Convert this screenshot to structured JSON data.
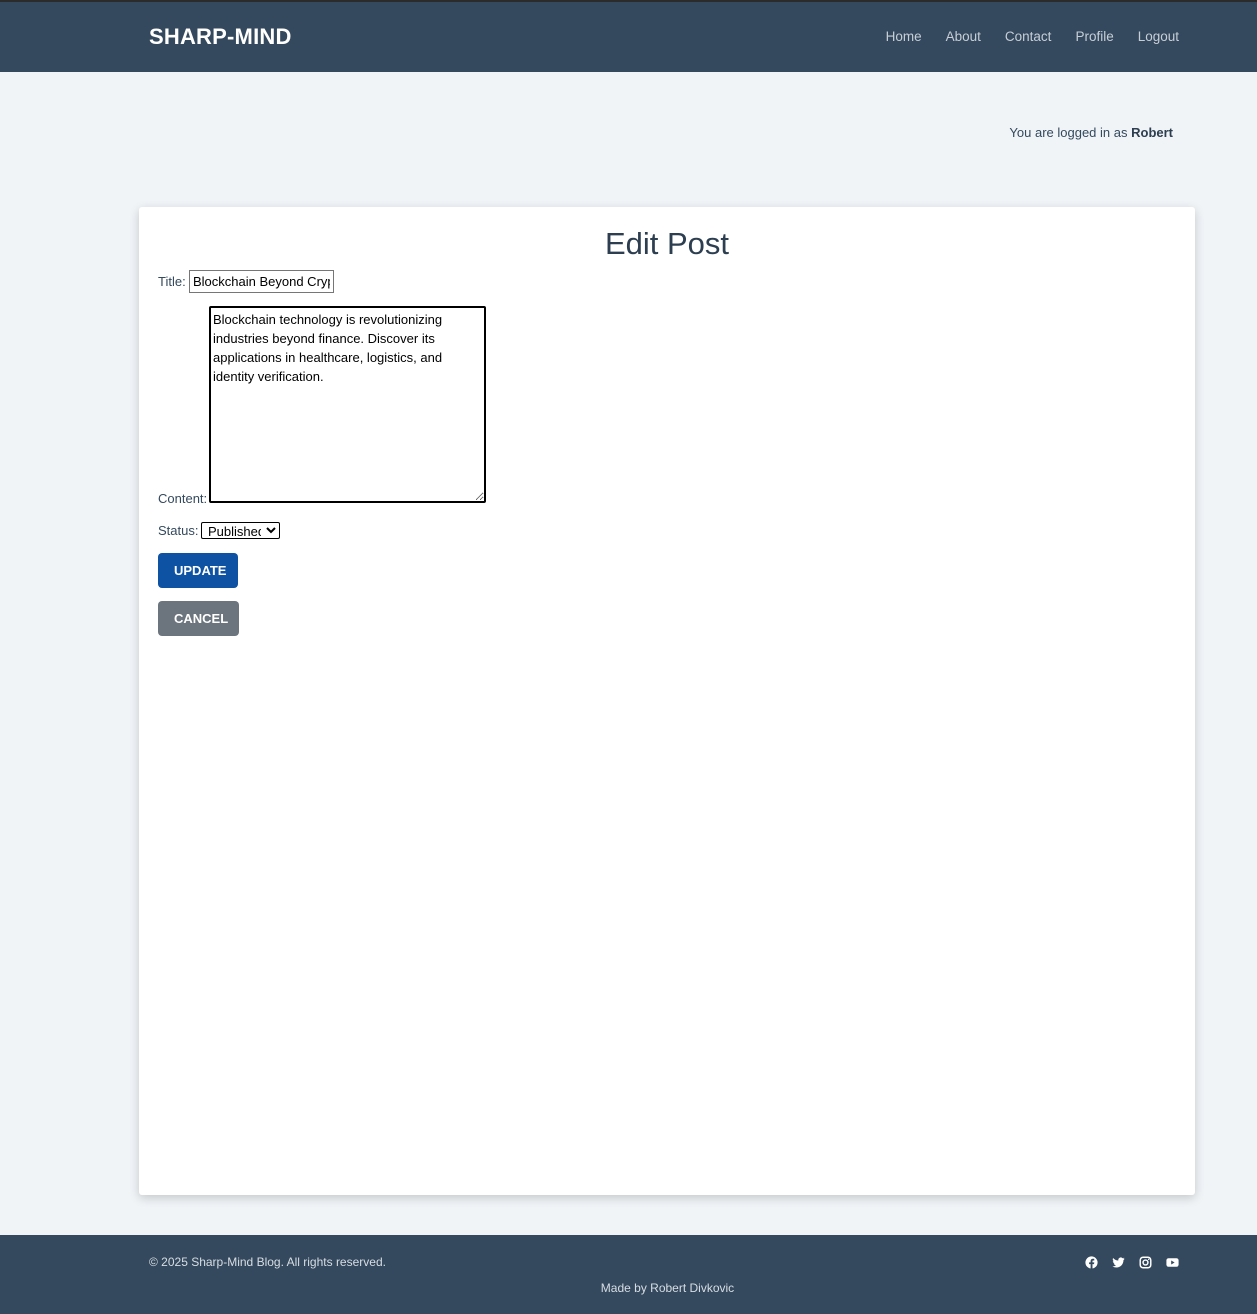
{
  "header": {
    "brand": "SHARP-MIND",
    "nav": [
      {
        "label": "Home"
      },
      {
        "label": "About"
      },
      {
        "label": "Contact"
      },
      {
        "label": "Profile"
      },
      {
        "label": "Logout"
      }
    ]
  },
  "login": {
    "prefix": "You are logged in as",
    "username": "Robert"
  },
  "form": {
    "heading": "Edit Post",
    "title_label": "Title:",
    "title_value": "Blockchain Beyond Cryptocurrency",
    "content_label": "Content:",
    "content_value": "Blockchain technology is revolutionizing industries beyond finance. Discover its applications in healthcare, logistics, and identity verification.",
    "status_label": "Status:",
    "status_value": "Published",
    "update_label": "Update",
    "cancel_label": "Cancel"
  },
  "footer": {
    "copyright": "© 2025 Sharp-Mind Blog. All rights reserved.",
    "made_by": "Made by Robert Divkovic",
    "socials": [
      {
        "icon": "facebook-icon"
      },
      {
        "icon": "twitter-icon"
      },
      {
        "icon": "instagram-icon"
      },
      {
        "icon": "youtube-icon"
      }
    ]
  },
  "colors": {
    "nav_bg": "#34495e",
    "page_bg": "#f0f4f7",
    "update_button": "#0d52a3",
    "cancel_button": "#6c757d"
  }
}
